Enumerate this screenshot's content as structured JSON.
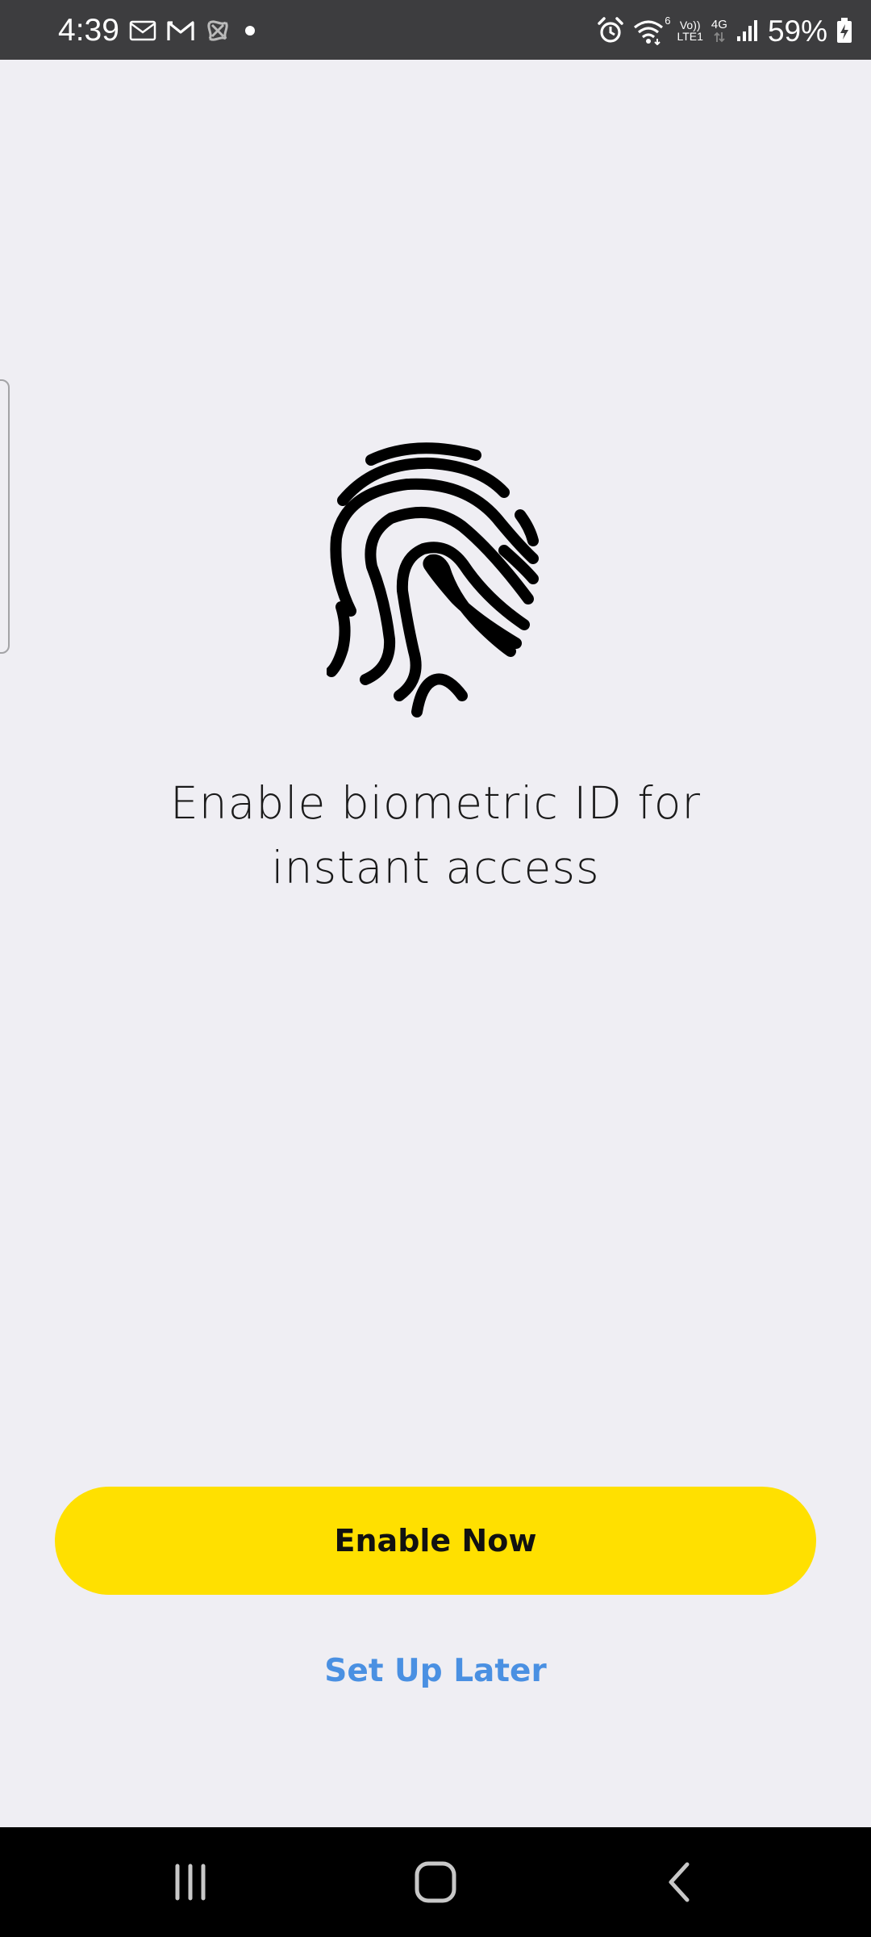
{
  "status_bar": {
    "time": "4:39",
    "battery": "59%",
    "network_top": "Vo))",
    "network_bottom": "LTE1",
    "network_type": "4G",
    "wifi_sub": "6",
    "icons": [
      "mail-icon",
      "gmail-icon",
      "app-notification-icon",
      "dot-icon",
      "alarm-icon",
      "wifi-icon",
      "signal-icon",
      "battery-charging-icon"
    ]
  },
  "content": {
    "icon": "fingerprint-icon",
    "headline_line1": "Enable biometric ID for",
    "headline_line2": "instant access"
  },
  "actions": {
    "enable_now": "Enable Now",
    "set_up_later": "Set Up Later"
  },
  "colors": {
    "accent_yellow": "#ffe000",
    "link_blue": "#4a90e2",
    "background": "#efeef3"
  },
  "nav_bar": {
    "icons": [
      "recent-apps-icon",
      "home-icon",
      "back-icon"
    ]
  }
}
